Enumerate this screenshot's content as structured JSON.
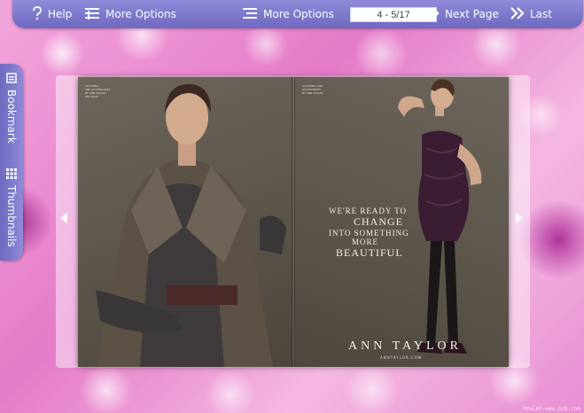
{
  "toolbar": {
    "help_label": "Help",
    "more_options_1_label": "More Options",
    "more_options_2_label": "More Options",
    "page_indicator": "4 - 5/17",
    "next_page_label": "Next Page",
    "last_label": "Last"
  },
  "side_tabs": {
    "bookmark_label": "Bookmark",
    "thumbnails_label": "Thumbnails"
  },
  "book": {
    "left_page_credit": "CLOTHING\nAND ACCESSORIES\nBY ANN TAYLOR\nSEE PAGE",
    "right_page_credit": "CLOTHING AND\nACCESSORIES\nBY ANN TAYLOR",
    "ad_line1": "WE'RE READY TO",
    "ad_line2": "CHANGE",
    "ad_line3": "INTO SOMETHING",
    "ad_line4": "MORE",
    "ad_line5": "BEAUTIFUL",
    "brand": "ANN TAYLOR",
    "brand_sub": "ANNTAYLOR.COM"
  },
  "watermark": "©ǲLAY·www.pc6.com",
  "colors": {
    "toolbar": "#7d78cc",
    "background_pink": "#e98fd2",
    "page_dark": "#5a5348"
  },
  "icons": {
    "help": "question-mark-icon",
    "more_options_1": "menu-lines-icon",
    "more_options_2": "menu-lines-right-icon",
    "next_page": "chevron-right-icon",
    "last": "double-chevron-right-icon",
    "bookmark": "bookmark-icon",
    "thumbnails": "grid-icon",
    "prev_arrow": "triangle-left-icon",
    "next_arrow": "triangle-right-icon"
  }
}
